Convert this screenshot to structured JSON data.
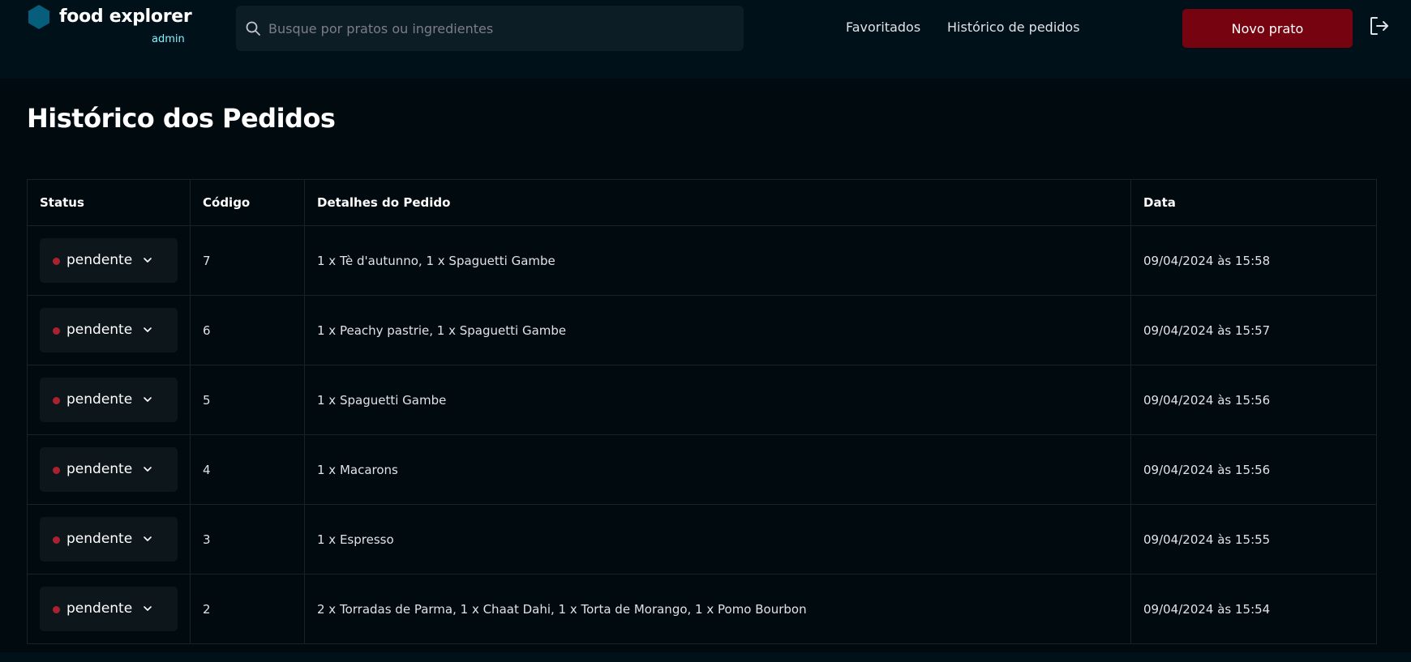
{
  "header": {
    "logo_text": "food explorer",
    "logo_sub": "admin",
    "search_placeholder": "Busque por pratos ou ingredientes",
    "nav": {
      "favorites": "Favoritados",
      "order_history": "Histórico de pedidos"
    },
    "new_dish_button": "Novo prato",
    "icons": {
      "logo": "hexagon-icon",
      "search": "search-icon",
      "logout": "sign-out-icon"
    },
    "colors": {
      "accent": "#750310",
      "logo": "#065e7c",
      "admin": "#82f3ff"
    }
  },
  "page": {
    "title": "Histórico dos Pedidos"
  },
  "table": {
    "columns": [
      "Status",
      "Código",
      "Detalhes do Pedido",
      "Data"
    ],
    "rows": [
      {
        "status": "pendente",
        "code": "7",
        "details": "1 x Tè d'autunno, 1 x Spaguetti Gambe",
        "date": "09/04/2024 às 15:58"
      },
      {
        "status": "pendente",
        "code": "6",
        "details": "1 x Peachy pastrie, 1 x Spaguetti Gambe",
        "date": "09/04/2024 às 15:57"
      },
      {
        "status": "pendente",
        "code": "5",
        "details": "1 x Spaguetti Gambe",
        "date": "09/04/2024 às 15:56"
      },
      {
        "status": "pendente",
        "code": "4",
        "details": "1 x Macarons",
        "date": "09/04/2024 às 15:56"
      },
      {
        "status": "pendente",
        "code": "3",
        "details": "1 x Espresso",
        "date": "09/04/2024 às 15:55"
      },
      {
        "status": "pendente",
        "code": "2",
        "details": "2 x Torradas de Parma, 1 x Chaat Dahi, 1 x Torta de Morango, 1 x Pomo Bourbon",
        "date": "09/04/2024 às 15:54"
      }
    ],
    "status_dot_color": "#ab222e"
  }
}
